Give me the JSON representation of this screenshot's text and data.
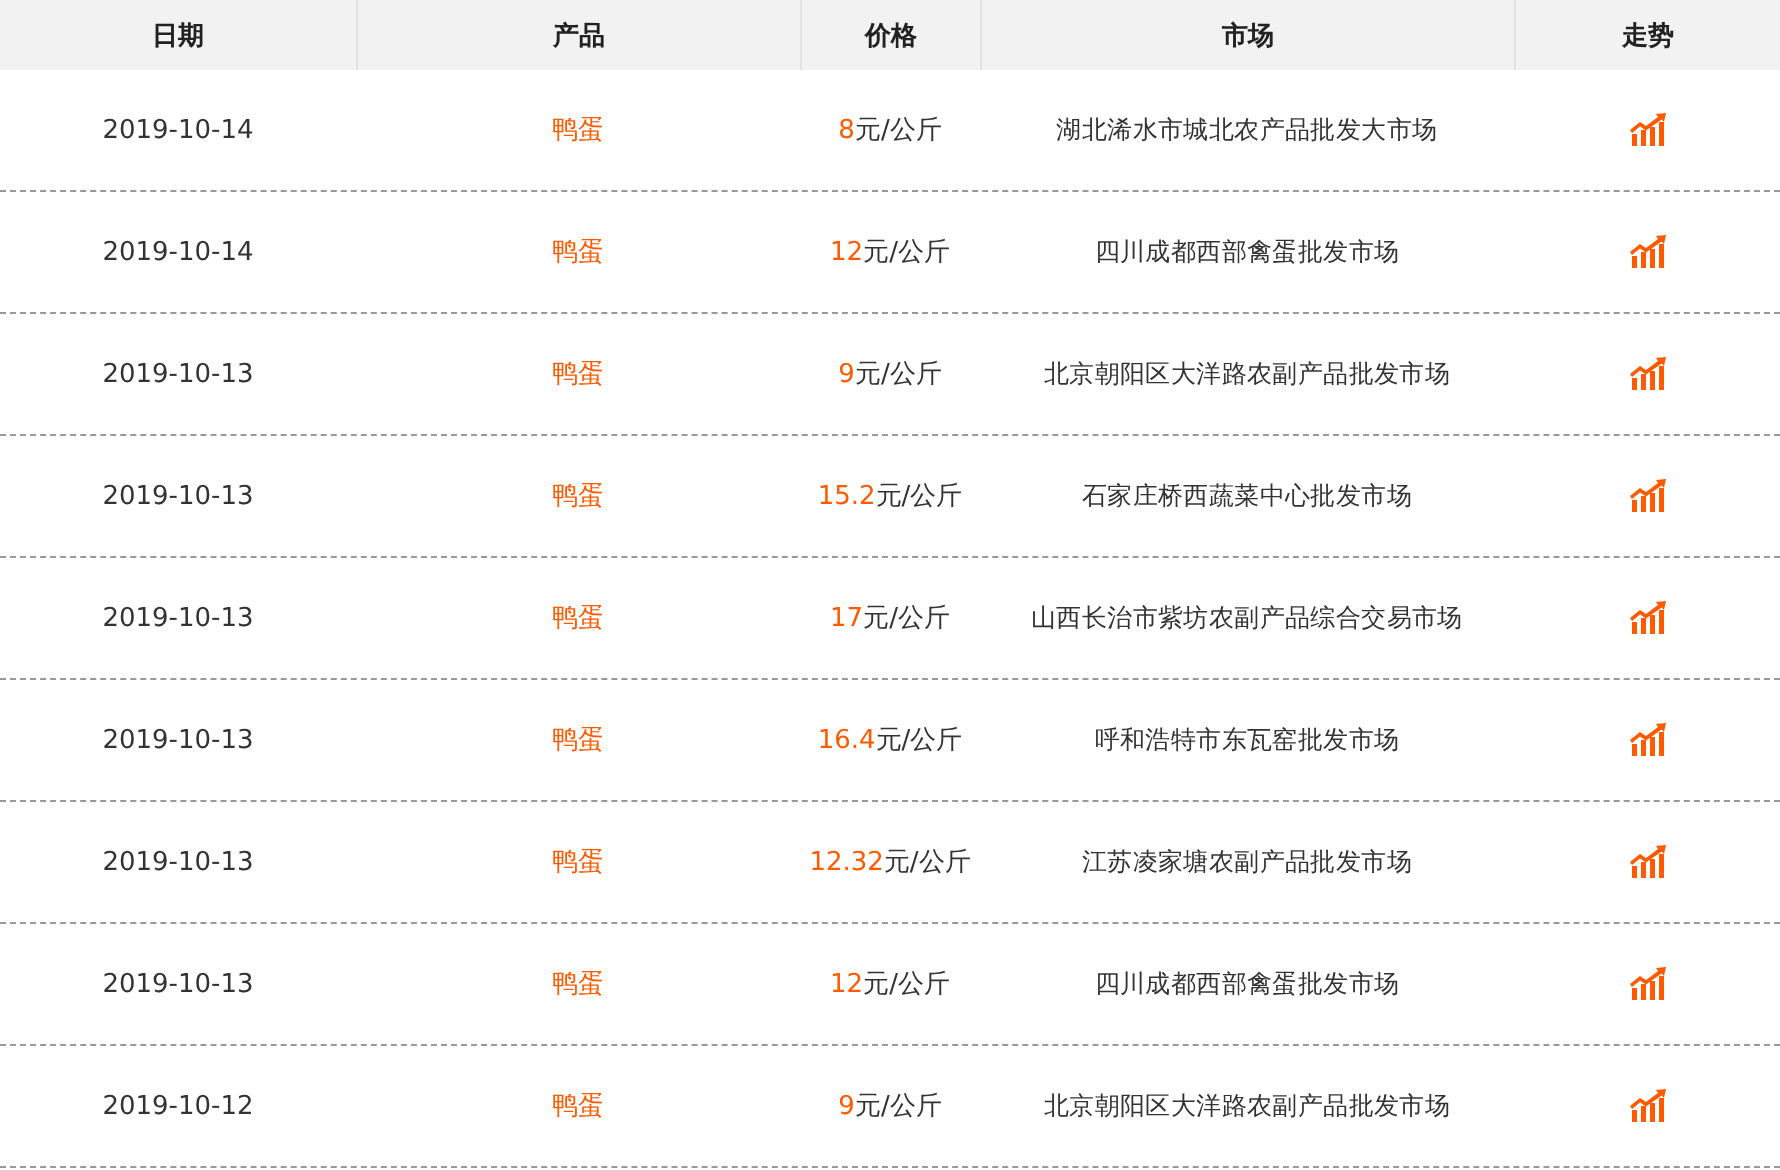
{
  "table": {
    "columns": [
      "日期",
      "产品",
      "价格",
      "市场",
      "走势"
    ],
    "rows": [
      {
        "date": "2019-10-14",
        "product": "鸭蛋",
        "amount": "8",
        "unit": "元/公斤",
        "market": "湖北浠水市城北农产品批发大市场"
      },
      {
        "date": "2019-10-14",
        "product": "鸭蛋",
        "amount": "12",
        "unit": "元/公斤",
        "market": "四川成都西部禽蛋批发市场"
      },
      {
        "date": "2019-10-13",
        "product": "鸭蛋",
        "amount": "9",
        "unit": "元/公斤",
        "market": "北京朝阳区大洋路农副产品批发市场"
      },
      {
        "date": "2019-10-13",
        "product": "鸭蛋",
        "amount": "15.2",
        "unit": "元/公斤",
        "market": "石家庄桥西蔬菜中心批发市场"
      },
      {
        "date": "2019-10-13",
        "product": "鸭蛋",
        "amount": "17",
        "unit": "元/公斤",
        "market": "山西长治市紫坊农副产品综合交易市场"
      },
      {
        "date": "2019-10-13",
        "product": "鸭蛋",
        "amount": "16.4",
        "unit": "元/公斤",
        "market": "呼和浩特市东瓦窑批发市场"
      },
      {
        "date": "2019-10-13",
        "product": "鸭蛋",
        "amount": "12.32",
        "unit": "元/公斤",
        "market": "江苏凌家塘农副产品批发市场"
      },
      {
        "date": "2019-10-13",
        "product": "鸭蛋",
        "amount": "12",
        "unit": "元/公斤",
        "market": "四川成都西部禽蛋批发市场"
      },
      {
        "date": "2019-10-12",
        "product": "鸭蛋",
        "amount": "9",
        "unit": "元/公斤",
        "market": "北京朝阳区大洋路农副产品批发市场"
      }
    ]
  }
}
